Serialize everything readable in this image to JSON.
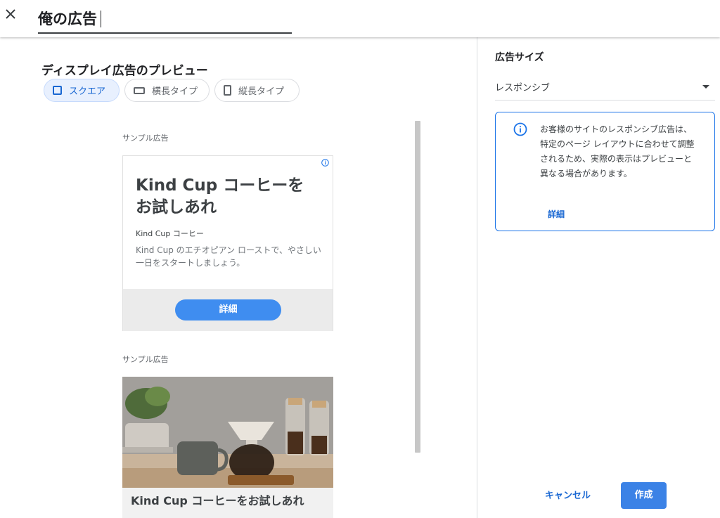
{
  "header": {
    "title_value": "俺の広告",
    "close_icon": "close-icon"
  },
  "preview": {
    "section_title": "ディスプレイ広告のプレビュー",
    "tabs": [
      {
        "label": "スクエア",
        "icon": "square-icon",
        "selected": true
      },
      {
        "label": "横長タイプ",
        "icon": "landscape-icon",
        "selected": false
      },
      {
        "label": "縦長タイプ",
        "icon": "portrait-icon",
        "selected": false
      }
    ],
    "ads": [
      {
        "sample_label": "サンプル広告",
        "headline": "Kind Cup コーヒーをお試しあれ",
        "advertiser": "Kind Cup コーヒー",
        "description": "Kind Cup のエチオピアン ローストで、やさしい一日をスタートしましょう。",
        "cta": "詳細"
      },
      {
        "sample_label": "サンプル広告",
        "headline": "Kind Cup コーヒーをお試しあれ"
      }
    ]
  },
  "side_panel": {
    "size_title": "広告サイズ",
    "size_value": "レスポンシブ",
    "info_message": "お客様のサイトのレスポンシブ広告は、特定のページ レイアウトに合わせて調整されるため、実際の表示はプレビューと異なる場合があります。",
    "info_link": "詳細",
    "cancel_label": "キャンセル",
    "create_label": "作成"
  },
  "colors": {
    "accent": "#1a73e8",
    "cta_blue": "#3f8df0",
    "chip_selected_bg": "#e8f0fe"
  }
}
